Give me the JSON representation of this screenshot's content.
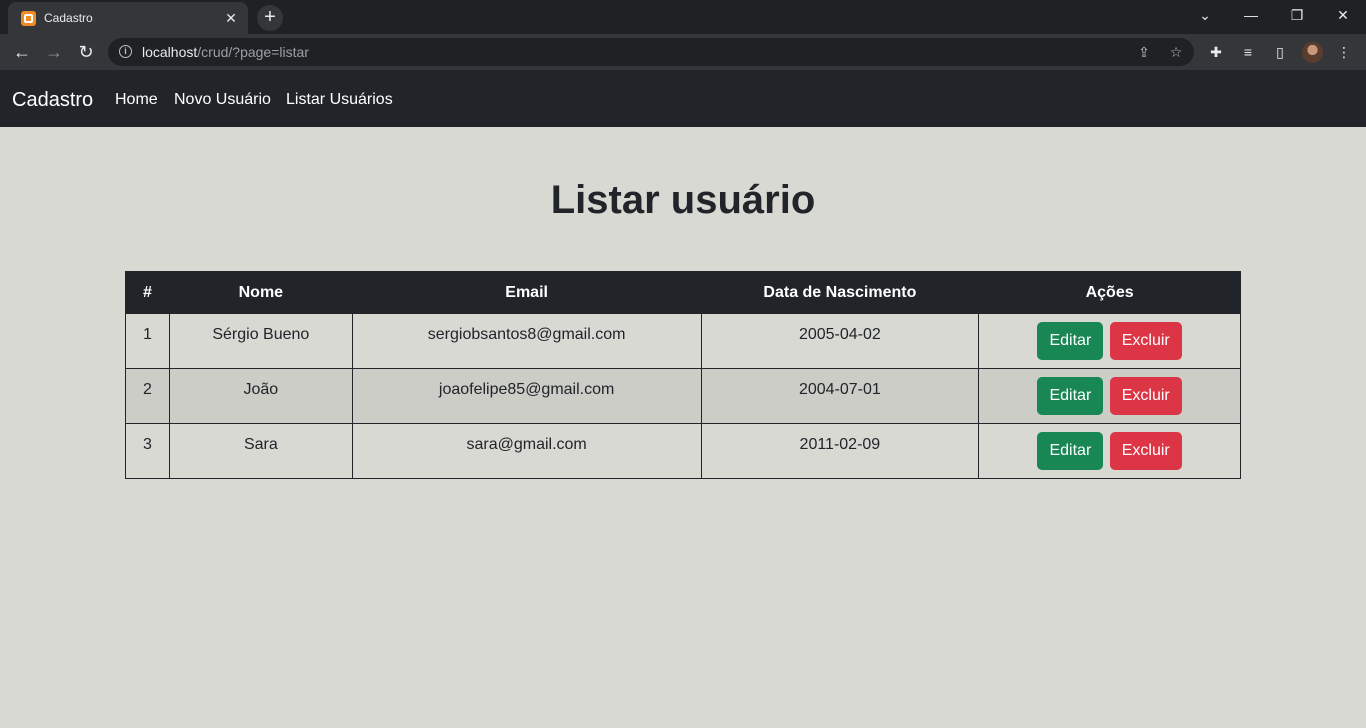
{
  "browser": {
    "tab_title": "Cadastro",
    "tab_close": "✕",
    "new_tab": "+",
    "url_host": "localhost",
    "url_path": "/crud/?page=listar"
  },
  "navbar": {
    "brand": "Cadastro",
    "links": [
      "Home",
      "Novo Usuário",
      "Listar Usuários"
    ]
  },
  "main": {
    "title": "Listar usuário",
    "table": {
      "headers": [
        "#",
        "Nome",
        "Email",
        "Data de Nascimento",
        "Ações"
      ],
      "rows": [
        {
          "id": "1",
          "nome": "Sérgio Bueno",
          "email": "sergiobsantos8@gmail.com",
          "nascimento": "2005-04-02"
        },
        {
          "id": "2",
          "nome": "João",
          "email": "joaofelipe85@gmail.com",
          "nascimento": "2004-07-01"
        },
        {
          "id": "3",
          "nome": "Sara",
          "email": "sara@gmail.com",
          "nascimento": "2011-02-09"
        }
      ],
      "edit_label": "Editar",
      "delete_label": "Excluir"
    }
  },
  "colors": {
    "navbar_bg": "#212529",
    "edit_button": "#198754",
    "delete_button": "#dc3545",
    "page_bg": "#d9d9d4"
  }
}
